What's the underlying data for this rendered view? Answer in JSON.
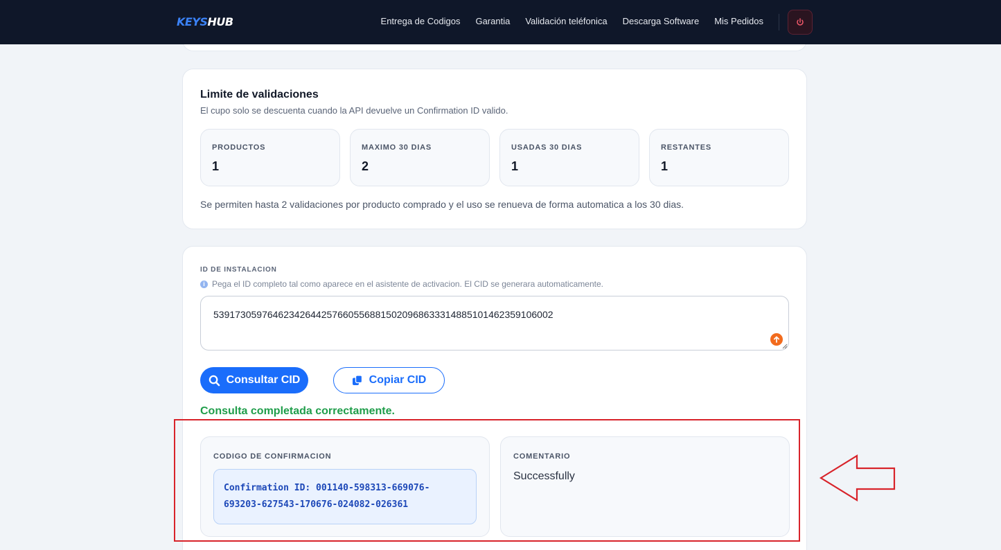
{
  "header": {
    "logo_part1": "KEYS",
    "logo_part2": "HUB",
    "nav": [
      {
        "label": "Entrega de Codigos"
      },
      {
        "label": "Garantia"
      },
      {
        "label": "Validación teléfonica"
      },
      {
        "label": "Descarga Software"
      },
      {
        "label": "Mis Pedidos"
      }
    ],
    "logout_icon": "power-icon"
  },
  "limits": {
    "title": "Limite de validaciones",
    "subtitle": "El cupo solo se descuenta cuando la API devuelve un Confirmation ID valido.",
    "stats": [
      {
        "label": "PRODUCTOS",
        "value": "1"
      },
      {
        "label": "MAXIMO 30 DIAS",
        "value": "2"
      },
      {
        "label": "USADAS 30 DIAS",
        "value": "1"
      },
      {
        "label": "RESTANTES",
        "value": "1"
      }
    ],
    "note": "Se permiten hasta 2 validaciones por producto comprado y el uso se renueva de forma automatica a los 30 dias."
  },
  "installation": {
    "label": "ID DE INSTALACION",
    "hint": "Pega el ID completo tal como aparece en el asistente de activacion. El CID se generara automaticamente.",
    "value": "539173059764623426442576605568815020968633314885101462359106002",
    "consult_button": "Consultar CID",
    "copy_button": "Copiar CID",
    "status": "Consulta completada correctamente."
  },
  "result": {
    "code_label": "CODIGO DE CONFIRMACION",
    "code_line1": "Confirmation ID: 001140-598313-669076-",
    "code_line2": "693203-627543-170676-024082-026361",
    "comment_label": "COMENTARIO",
    "comment": "Successfully"
  },
  "colors": {
    "navbar": "#0f1729",
    "accent": "#1a6dfb",
    "success": "#1f9d4a",
    "annotation": "#d8232a"
  }
}
